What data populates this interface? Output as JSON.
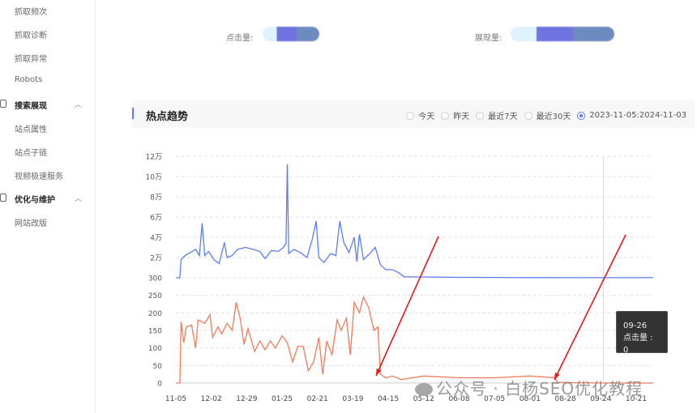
{
  "sidebar": {
    "items": [
      "抓取频次",
      "抓取诊断",
      "抓取异常",
      "Robots"
    ],
    "groups": [
      {
        "label": "搜索展现",
        "expanded": true,
        "items": [
          "站点属性",
          "站点子链",
          "视频极速服务"
        ]
      },
      {
        "label": "优化与维护",
        "expanded": true,
        "items": [
          "网站改版"
        ]
      }
    ]
  },
  "stats": {
    "clicks_label": "点击量:",
    "impressions_label": "展现量:"
  },
  "panel": {
    "title": "热点趋势",
    "ranges": [
      {
        "label": "今天",
        "selected": false
      },
      {
        "label": "昨天",
        "selected": false
      },
      {
        "label": "最近7天",
        "selected": false
      },
      {
        "label": "最近30天",
        "selected": false
      },
      {
        "label": "2023-11-05:2024-11-03",
        "selected": true
      }
    ]
  },
  "tooltip": {
    "date": "09-26",
    "text": "点击量 : 0"
  },
  "watermark": "公众号 · 白杨SEO优化教程",
  "chart_data": {
    "type": "line",
    "x_ticks": [
      "11-05",
      "12-02",
      "12-29",
      "01-25",
      "02-21",
      "03-19",
      "04-15",
      "05-12",
      "06-08",
      "07-05",
      "08-01",
      "08-28",
      "09-24",
      "10-21"
    ],
    "x_range": [
      "2023-11-05",
      "2024-11-03"
    ],
    "colors": {
      "impressions": "#5b7cf7",
      "clicks": "#f47a5a"
    },
    "grid": true,
    "panels": [
      {
        "y_ticks": [
          "300",
          "2万",
          "4万",
          "6万",
          "8万",
          "10万",
          "12万"
        ],
        "ylim": [
          0,
          120000
        ],
        "series": [
          {
            "color": "#5b7cf7",
            "points": [
              [
                "2023-11-05",
                0
              ],
              [
                "2023-11-08",
                0
              ],
              [
                "2023-11-09",
                18000
              ],
              [
                "2023-11-12",
                22000
              ],
              [
                "2023-11-16",
                25000
              ],
              [
                "2023-11-20",
                28000
              ],
              [
                "2023-11-23",
                22000
              ],
              [
                "2023-11-25",
                54000
              ],
              [
                "2023-11-27",
                22000
              ],
              [
                "2023-11-30",
                26000
              ],
              [
                "2023-12-04",
                18000
              ],
              [
                "2023-12-08",
                14000
              ],
              [
                "2023-12-12",
                35000
              ],
              [
                "2023-12-14",
                20000
              ],
              [
                "2023-12-18",
                22000
              ],
              [
                "2023-12-22",
                28000
              ],
              [
                "2023-12-28",
                30000
              ],
              [
                "2024-01-03",
                28000
              ],
              [
                "2024-01-08",
                26000
              ],
              [
                "2024-01-12",
                19000
              ],
              [
                "2024-01-17",
                27000
              ],
              [
                "2024-01-22",
                26000
              ],
              [
                "2024-01-26",
                30000
              ],
              [
                "2024-01-28",
                34000
              ],
              [
                "2024-01-29",
                112000
              ],
              [
                "2024-01-30",
                24000
              ],
              [
                "2024-02-03",
                28000
              ],
              [
                "2024-02-08",
                25000
              ],
              [
                "2024-02-13",
                20000
              ],
              [
                "2024-02-17",
                38000
              ],
              [
                "2024-02-20",
                56000
              ],
              [
                "2024-02-22",
                20000
              ],
              [
                "2024-02-26",
                15000
              ],
              [
                "2024-03-02",
                24000
              ],
              [
                "2024-03-06",
                22000
              ],
              [
                "2024-03-09",
                56000
              ],
              [
                "2024-03-12",
                35000
              ],
              [
                "2024-03-16",
                25000
              ],
              [
                "2024-03-20",
                40000
              ],
              [
                "2024-03-22",
                16000
              ],
              [
                "2024-03-24",
                43000
              ],
              [
                "2024-03-27",
                18000
              ],
              [
                "2024-04-01",
                24000
              ],
              [
                "2024-04-05",
                30000
              ],
              [
                "2024-04-09",
                13000
              ],
              [
                "2024-04-13",
                8000
              ],
              [
                "2024-04-18",
                8000
              ],
              [
                "2024-04-23",
                5000
              ],
              [
                "2024-04-27",
                1000
              ],
              [
                "2024-05-12",
                800
              ],
              [
                "2024-06-08",
                400
              ],
              [
                "2024-07-05",
                300
              ],
              [
                "2024-08-01",
                200
              ],
              [
                "2024-09-01",
                100
              ],
              [
                "2024-11-03",
                100
              ]
            ]
          }
        ]
      },
      {
        "y_ticks": [
          "0",
          "50",
          "100",
          "150",
          "200",
          "250"
        ],
        "ylim": [
          0,
          300
        ],
        "series": [
          {
            "color": "#f47a5a",
            "points": [
              [
                "2023-11-05",
                0
              ],
              [
                "2023-11-08",
                0
              ],
              [
                "2023-11-09",
                175
              ],
              [
                "2023-11-11",
                115
              ],
              [
                "2023-11-13",
                160
              ],
              [
                "2023-11-17",
                165
              ],
              [
                "2023-11-20",
                100
              ],
              [
                "2023-11-22",
                180
              ],
              [
                "2023-11-27",
                170
              ],
              [
                "2023-12-01",
                195
              ],
              [
                "2023-12-03",
                130
              ],
              [
                "2023-12-07",
                160
              ],
              [
                "2023-12-10",
                140
              ],
              [
                "2023-12-14",
                170
              ],
              [
                "2023-12-18",
                150
              ],
              [
                "2023-12-21",
                230
              ],
              [
                "2023-12-24",
                185
              ],
              [
                "2023-12-27",
                110
              ],
              [
                "2023-12-30",
                155
              ],
              [
                "2024-01-04",
                90
              ],
              [
                "2024-01-08",
                120
              ],
              [
                "2024-01-12",
                95
              ],
              [
                "2024-01-16",
                120
              ],
              [
                "2024-01-20",
                100
              ],
              [
                "2024-01-25",
                135
              ],
              [
                "2024-01-29",
                115
              ],
              [
                "2024-02-02",
                60
              ],
              [
                "2024-02-06",
                105
              ],
              [
                "2024-02-10",
                105
              ],
              [
                "2024-02-14",
                35
              ],
              [
                "2024-02-18",
                60
              ],
              [
                "2024-02-22",
                130
              ],
              [
                "2024-02-25",
                25
              ],
              [
                "2024-02-28",
                120
              ],
              [
                "2024-03-03",
                80
              ],
              [
                "2024-03-07",
                180
              ],
              [
                "2024-03-10",
                150
              ],
              [
                "2024-03-14",
                185
              ],
              [
                "2024-03-17",
                80
              ],
              [
                "2024-03-20",
                230
              ],
              [
                "2024-03-24",
                200
              ],
              [
                "2024-03-27",
                245
              ],
              [
                "2024-03-31",
                215
              ],
              [
                "2024-04-04",
                150
              ],
              [
                "2024-04-07",
                160
              ],
              [
                "2024-04-09",
                25
              ],
              [
                "2024-04-13",
                15
              ],
              [
                "2024-04-18",
                20
              ],
              [
                "2024-04-25",
                10
              ],
              [
                "2024-05-12",
                20
              ],
              [
                "2024-06-08",
                15
              ],
              [
                "2024-07-05",
                15
              ],
              [
                "2024-08-01",
                20
              ],
              [
                "2024-08-20",
                15
              ],
              [
                "2024-08-22",
                2
              ],
              [
                "2024-09-26",
                0
              ],
              [
                "2024-11-03",
                0
              ]
            ]
          }
        ]
      }
    ]
  }
}
